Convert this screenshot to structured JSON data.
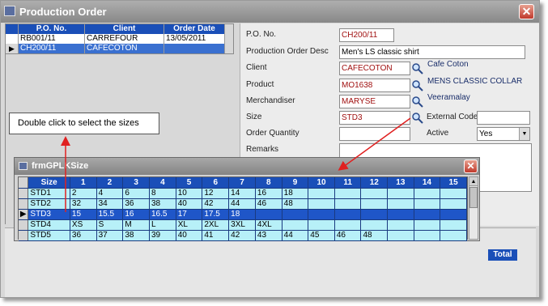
{
  "main_window": {
    "title": "Production Order",
    "close_glyph": "✕"
  },
  "order_grid": {
    "headers": [
      "P.O. No.",
      "Client",
      "Order Date"
    ],
    "rows": [
      {
        "po": "RB001/11",
        "client": "CARREFOUR",
        "date": "13/05/2011"
      },
      {
        "po": "CH200/11",
        "client": "CAFECOTON",
        "date": ""
      }
    ],
    "row_pointer": "▶"
  },
  "form": {
    "po_no_label": "P.O. No.",
    "po_no_value": "CH200/11",
    "desc_label": "Production Order Desc",
    "desc_value": "Men's LS classic shirt",
    "client_label": "Client",
    "client_value": "CAFECOTON",
    "client_info": "Cafe Coton",
    "product_label": "Product",
    "product_value": "MO1638",
    "product_info": "MENS CLASSIC COLLAR",
    "merch_label": "Merchandiser",
    "merch_value": "MARYSE",
    "merch_info": "Veeramalay",
    "size_label": "Size",
    "size_value": "STD3",
    "ext_code_label": "External Code",
    "ext_code_value": "",
    "qty_label": "Order Quantity",
    "qty_value": "",
    "active_label": "Active",
    "active_value": "Yes",
    "remarks_label": "Remarks",
    "remarks_value": ""
  },
  "bottom": {
    "total_header": "Total"
  },
  "callout": {
    "text": "Double click to select the sizes"
  },
  "size_dialog": {
    "title": "frmGPLKSize",
    "close_glyph": "✕",
    "headers": [
      "Size",
      "1",
      "2",
      "3",
      "4",
      "5",
      "6",
      "7",
      "8",
      "9",
      "10",
      "11",
      "12",
      "13",
      "14",
      "15"
    ],
    "row_pointer": "▶",
    "selected_row": 2,
    "rows": [
      {
        "cells": [
          "STD1",
          "2",
          "4",
          "6",
          "8",
          "10",
          "12",
          "14",
          "16",
          "18",
          "",
          "",
          "",
          "",
          "",
          ""
        ]
      },
      {
        "cells": [
          "STD2",
          "32",
          "34",
          "36",
          "38",
          "40",
          "42",
          "44",
          "46",
          "48",
          "",
          "",
          "",
          "",
          "",
          ""
        ]
      },
      {
        "cells": [
          "STD3",
          "15",
          "15.5",
          "16",
          "16.5",
          "17",
          "17.5",
          "18",
          "",
          "",
          "",
          "",
          "",
          "",
          "",
          ""
        ]
      },
      {
        "cells": [
          "STD4",
          "XS",
          "S",
          "M",
          "L",
          "XL",
          "2XL",
          "3XL",
          "4XL",
          "",
          "",
          "",
          "",
          "",
          "",
          ""
        ]
      },
      {
        "cells": [
          "STD5",
          "36",
          "37",
          "38",
          "39",
          "40",
          "41",
          "42",
          "43",
          "44",
          "45",
          "46",
          "48",
          "",
          "",
          ""
        ]
      }
    ]
  },
  "colors": {
    "header_blue": "#1a4fb8",
    "grid_cyan": "#b7f0f8",
    "selection_blue": "#1f56c8",
    "arrow_red": "#e02020"
  }
}
